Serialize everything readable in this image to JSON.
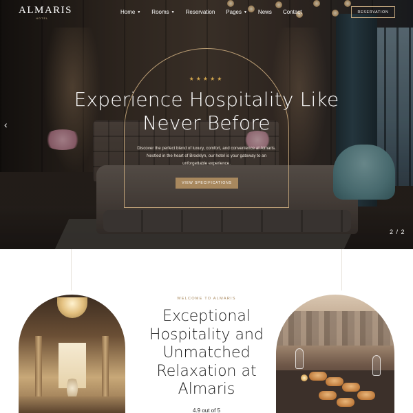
{
  "brand": {
    "name": "ALMARIS",
    "sub": "HOTEL"
  },
  "nav": {
    "items": [
      {
        "label": "Home",
        "has_dropdown": true
      },
      {
        "label": "Rooms",
        "has_dropdown": true
      },
      {
        "label": "Reservation",
        "has_dropdown": false
      },
      {
        "label": "Pages",
        "has_dropdown": true
      },
      {
        "label": "News",
        "has_dropdown": false
      },
      {
        "label": "Contact",
        "has_dropdown": false
      }
    ],
    "dropdown_glyph": "▼",
    "reservation_label": "RESERVATION"
  },
  "hero": {
    "stars": "★★★★★",
    "rating_stars": 5,
    "title": "Experience Hospitality Like Never Before",
    "description": "Discover the perfect blend of luxury, comfort, and convenience at Almaris. Nestled in the heart of Brooklyn, our hotel is your gateway to an unforgettable experience.",
    "button_label": "VIEW SPECIFICATIONS",
    "prev_arrow": "‹",
    "slide_counter": "2 / 2"
  },
  "welcome": {
    "label": "WELCOME TO ALMARIS",
    "title": "Exceptional Hospitality and Unmatched Relaxation at Almaris",
    "rating_text": "4.9 out of 5"
  },
  "colors": {
    "accent_gold": "#a8885e",
    "star_gold": "#d2a64e",
    "text_dark": "#1e1e1e",
    "white": "#ffffff"
  },
  "icons": {
    "prev": "chevron-left-icon",
    "dropdown": "chevron-down-icon",
    "star": "star-icon"
  }
}
